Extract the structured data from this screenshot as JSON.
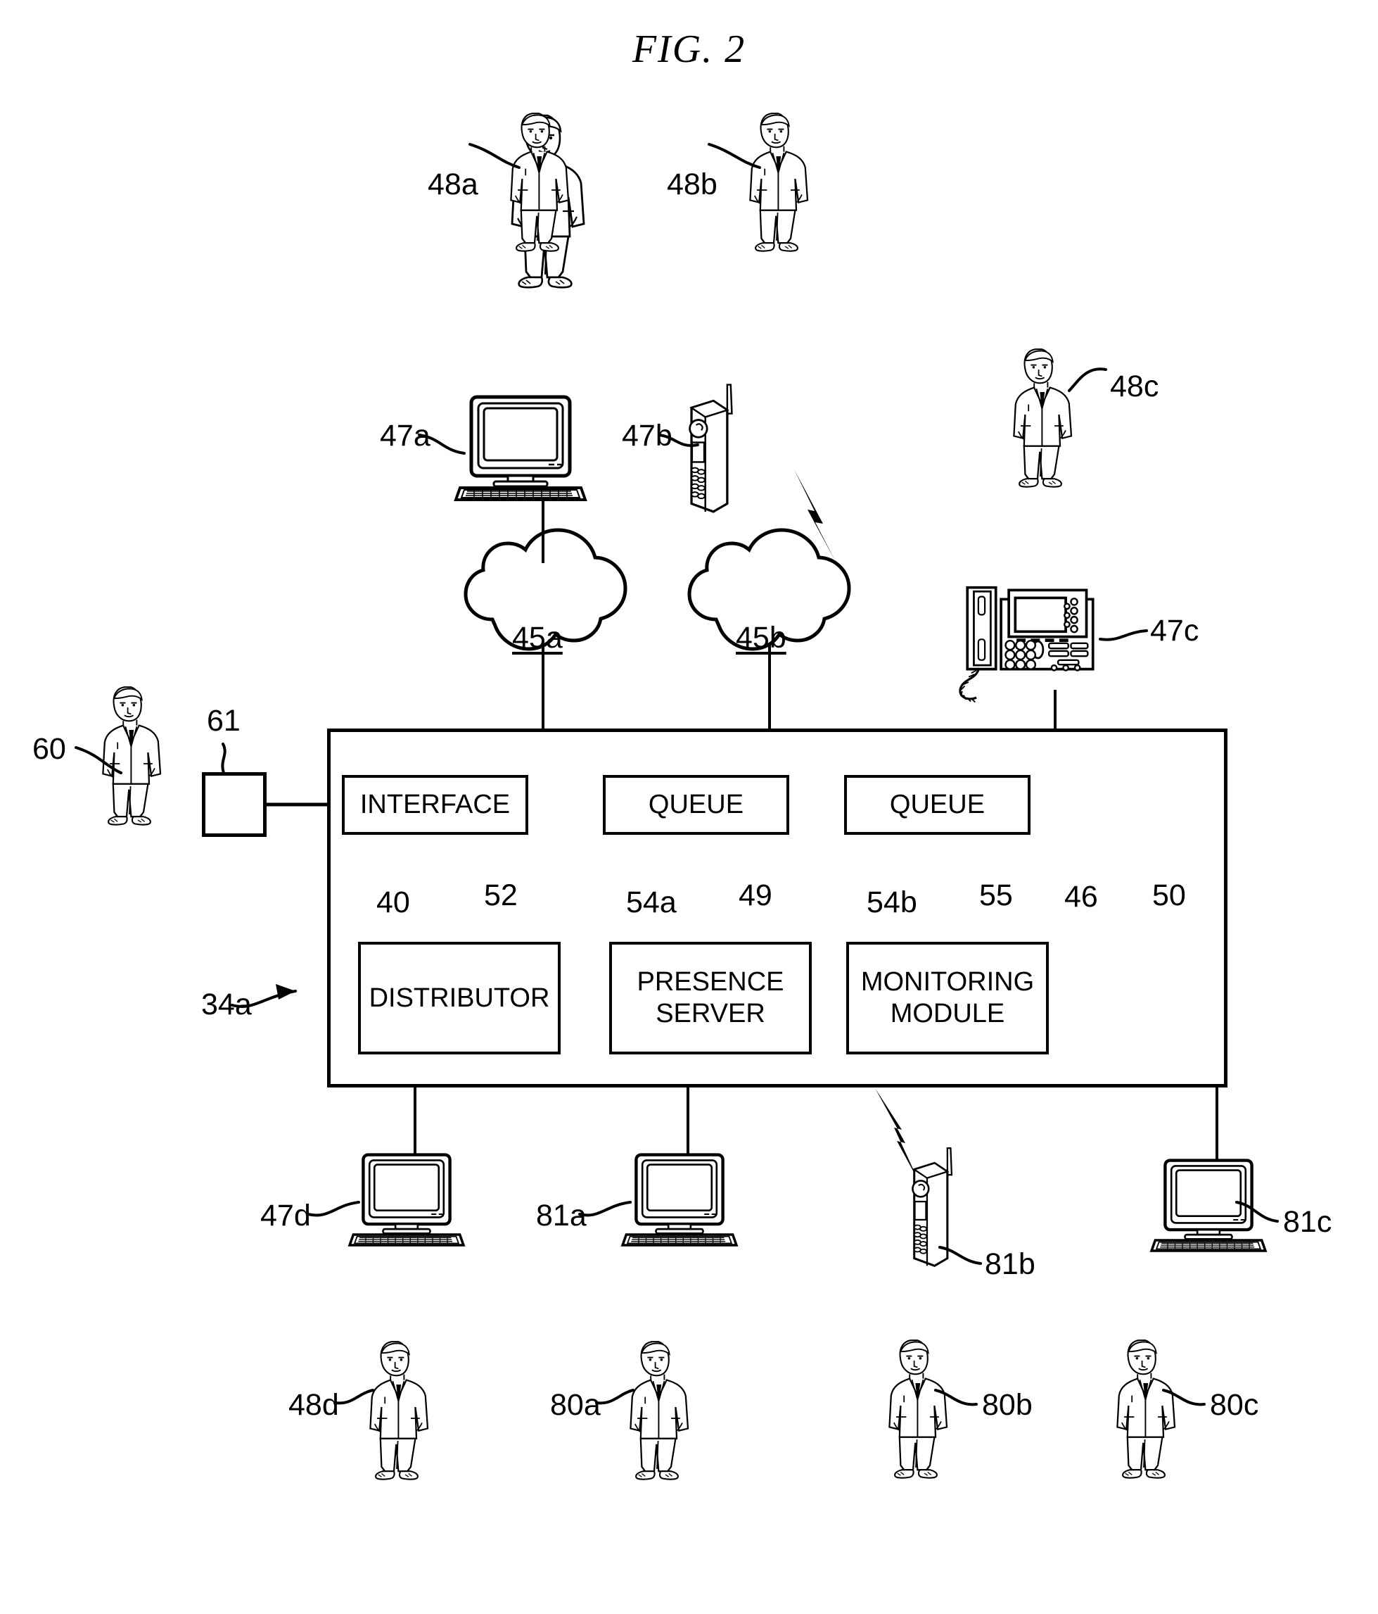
{
  "figure": {
    "title": "FIG. 2",
    "type": "patent-diagram",
    "description": "Communication system block diagram with contact center, networks, endpoints and users"
  },
  "refs": {
    "person_48a": "48a",
    "person_48b": "48b",
    "person_48c": "48c",
    "person_48d": "48d",
    "person_60": "60",
    "person_80a": "80a",
    "person_80b": "80b",
    "person_80c": "80c",
    "computer_47a": "47a",
    "mobile_47b": "47b",
    "deskphone_47c": "47c",
    "computer_47d": "47d",
    "computer_81a": "81a",
    "mobile_81b": "81b",
    "computer_81c": "81c",
    "cloud_45a": "45a",
    "cloud_45b": "45b",
    "box_61": "61",
    "system_34a": "34a",
    "interface_40": "40",
    "distributor_52": "52",
    "queue_54a": "54a",
    "presence_49": "49",
    "queue_54b": "54b",
    "monitoring_55": "55",
    "circle_46": "46",
    "database_50": "50"
  },
  "system": {
    "blocks": [
      {
        "id": "interface",
        "label": "INTERFACE",
        "ref": "40"
      },
      {
        "id": "queue_a",
        "label": "QUEUE",
        "ref": "54a"
      },
      {
        "id": "queue_b",
        "label": "QUEUE",
        "ref": "54b"
      },
      {
        "id": "distributor",
        "label": "DISTRIBUTOR",
        "ref": "52"
      },
      {
        "id": "presence_server",
        "label": "PRESENCE\nSERVER",
        "ref": "49"
      },
      {
        "id": "monitoring_module",
        "label": "MONITORING\nMODULE",
        "ref": "55"
      }
    ],
    "interface_label": "INTERFACE",
    "queue_a_label": "QUEUE",
    "queue_b_label": "QUEUE",
    "distributor_label": "DISTRIBUTOR",
    "presence_line1": "PRESENCE",
    "presence_line2": "SERVER",
    "monitoring_line1": "MONITORING",
    "monitoring_line2": "MODULE"
  },
  "icons": {
    "person": "person-icon",
    "desktop_computer": "desktop-computer-icon",
    "mobile_phone": "mobile-phone-icon",
    "desk_phone": "desk-phone-icon",
    "network_cloud": "network-cloud-icon",
    "database_cylinder": "database-cylinder-icon",
    "circle_node": "circle-node-icon",
    "lightning_bolt": "lightning-bolt-icon",
    "leader_line": "leader-line-icon",
    "arrow": "arrow-icon"
  },
  "colors": {
    "ink": "#000000",
    "paper": "#ffffff"
  }
}
